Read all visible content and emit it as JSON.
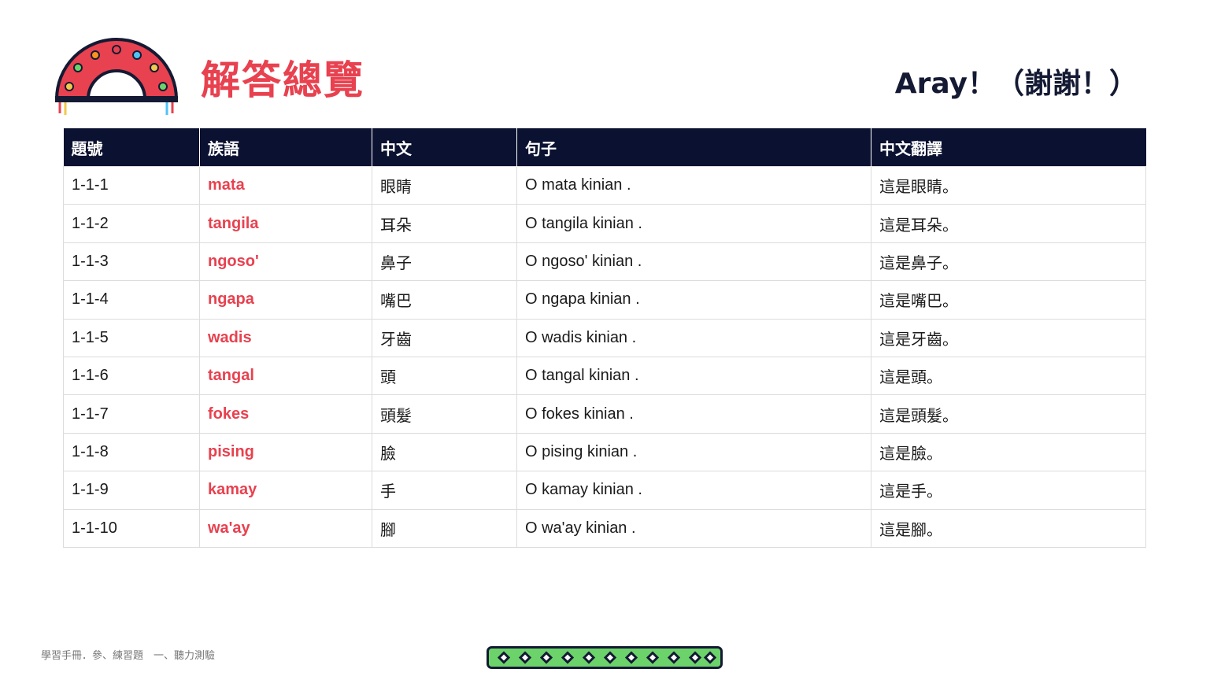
{
  "header": {
    "title": "解答總覽",
    "greeting": "Aray！（謝謝！）"
  },
  "colors": {
    "accent": "#e8414f",
    "header_bg": "#0b1130",
    "pattern_green": "#6cd36a"
  },
  "table": {
    "columns": [
      "題號",
      "族語",
      "中文",
      "句子",
      "中文翻譯"
    ],
    "rows": [
      {
        "id": "1-1-1",
        "word": "mata",
        "zh": "眼睛",
        "sentence": "O mata kinian .",
        "translation": "這是眼睛。"
      },
      {
        "id": "1-1-2",
        "word": "tangila",
        "zh": "耳朵",
        "sentence": "O tangila kinian .",
        "translation": "這是耳朵。"
      },
      {
        "id": "1-1-3",
        "word": "ngoso'",
        "zh": "鼻子",
        "sentence": "O ngoso' kinian .",
        "translation": "這是鼻子。"
      },
      {
        "id": "1-1-4",
        "word": "ngapa",
        "zh": "嘴巴",
        "sentence": "O ngapa kinian .",
        "translation": "這是嘴巴。"
      },
      {
        "id": "1-1-5",
        "word": "wadis",
        "zh": "牙齒",
        "sentence": "O wadis kinian .",
        "translation": "這是牙齒。"
      },
      {
        "id": "1-1-6",
        "word": "tangal",
        "zh": "頭",
        "sentence": "O tangal kinian .",
        "translation": "這是頭。"
      },
      {
        "id": "1-1-7",
        "word": "fokes",
        "zh": "頭髮",
        "sentence": "O fokes kinian .",
        "translation": "這是頭髮。"
      },
      {
        "id": "1-1-8",
        "word": "pising",
        "zh": "臉",
        "sentence": "O pising kinian .",
        "translation": "這是臉。"
      },
      {
        "id": "1-1-9",
        "word": "kamay",
        "zh": "手",
        "sentence": "O kamay kinian .",
        "translation": "這是手。"
      },
      {
        "id": "1-1-10",
        "word": "wa'ay",
        "zh": "腳",
        "sentence": "O wa'ay kinian .",
        "translation": "這是腳。"
      }
    ]
  },
  "footer": {
    "text": "學習手冊．參、練習題　一、聽力測驗"
  }
}
